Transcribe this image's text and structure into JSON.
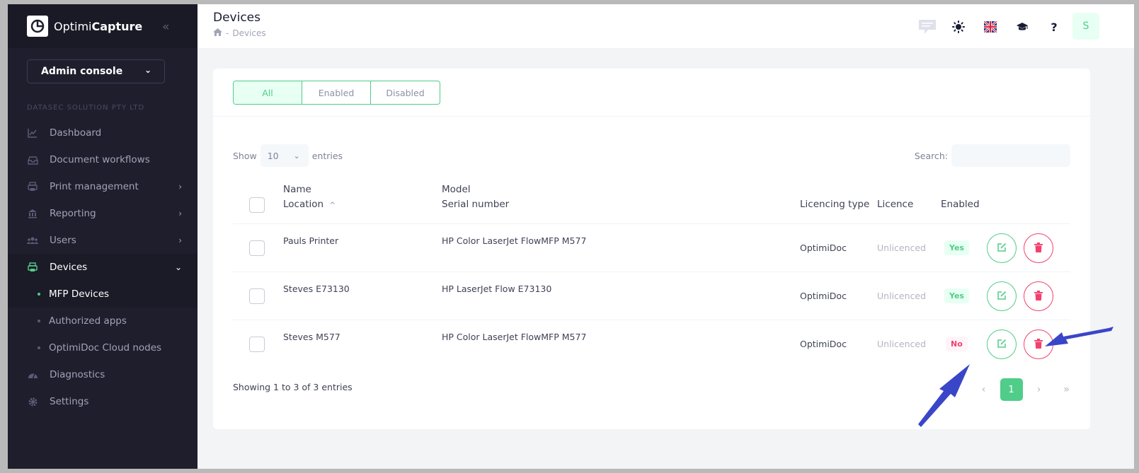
{
  "brand": {
    "name_light": "Optimi",
    "name_bold": "Capture"
  },
  "sidebar": {
    "console_label": "Admin console",
    "org": "DATASEC SOLUTION PTY LTD",
    "items": [
      {
        "label": "Dashboard",
        "icon": "chart-line-icon"
      },
      {
        "label": "Document workflows",
        "icon": "inbox-icon"
      },
      {
        "label": "Print management",
        "icon": "printer-icon"
      },
      {
        "label": "Reporting",
        "icon": "bank-icon"
      },
      {
        "label": "Users",
        "icon": "users-icon"
      },
      {
        "label": "Devices",
        "icon": "printer-icon"
      },
      {
        "label": "MFP Devices"
      },
      {
        "label": "Authorized apps"
      },
      {
        "label": "OptimiDoc Cloud nodes"
      },
      {
        "label": "Diagnostics",
        "icon": "gauge-icon"
      },
      {
        "label": "Settings",
        "icon": "gear-icon"
      }
    ]
  },
  "header": {
    "title": "Devices",
    "breadcrumb": {
      "sep": "-",
      "current": "Devices"
    },
    "help": "?",
    "avatar": "S"
  },
  "filters": {
    "all": "All",
    "enabled": "Enabled",
    "disabled": "Disabled",
    "active": "All"
  },
  "length": {
    "show": "Show",
    "value": "10",
    "entries": "entries"
  },
  "search": {
    "label": "Search:"
  },
  "table": {
    "headers": {
      "name": "Name",
      "location": "Location",
      "model": "Model",
      "serial": "Serial number",
      "licencing_type": "Licencing type",
      "licence": "Licence",
      "enabled": "Enabled"
    },
    "rows": [
      {
        "name": "Pauls Printer",
        "model": "HP Color LaserJet FlowMFP M577",
        "licencing_type": "OptimiDoc",
        "licence": "Unlicenced",
        "enabled": "Yes"
      },
      {
        "name": "Steves E73130",
        "model": "HP LaserJet Flow E73130",
        "licencing_type": "OptimiDoc",
        "licence": "Unlicenced",
        "enabled": "Yes"
      },
      {
        "name": "Steves M577",
        "model": "HP Color LaserJet FlowMFP M577",
        "licencing_type": "OptimiDoc",
        "licence": "Unlicenced",
        "enabled": "No"
      }
    ]
  },
  "footer": {
    "showing": "Showing 1 to 3 of 3 entries",
    "page": "1"
  },
  "colors": {
    "accent": "#50cd89",
    "danger": "#f1416c",
    "sidebar": "#1e1e2d",
    "annotation": "#3a46c8"
  }
}
